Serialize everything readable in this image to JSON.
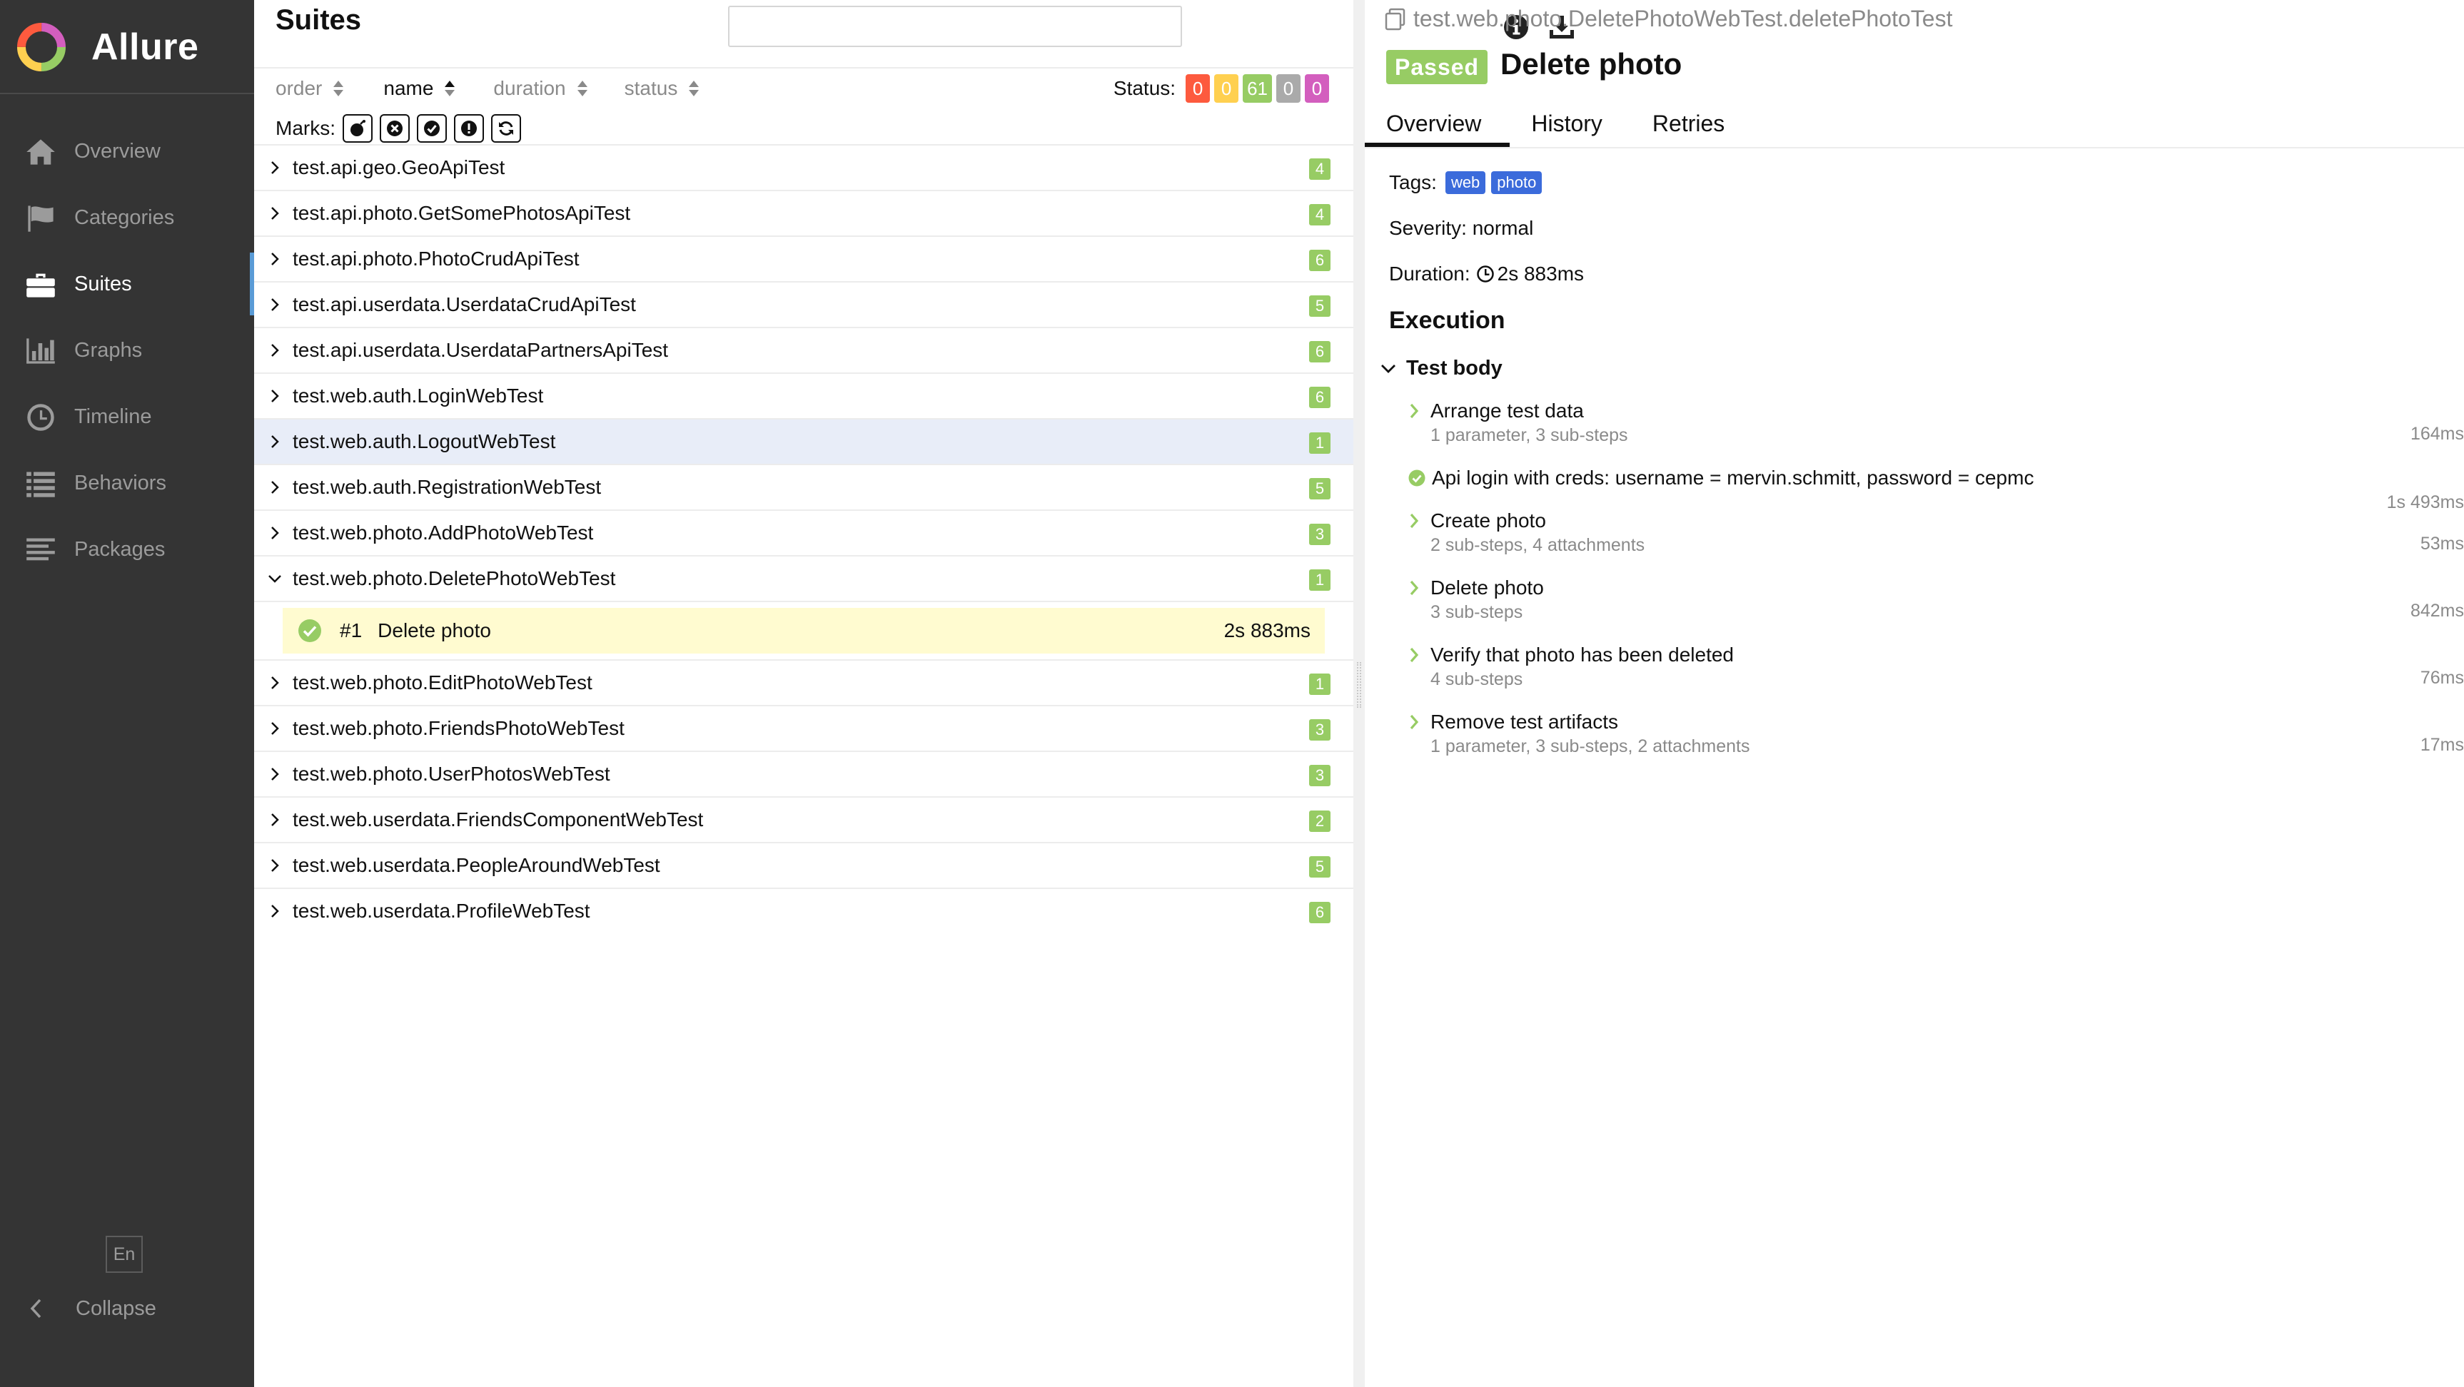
{
  "brand": {
    "name": "Allure"
  },
  "sidebar": {
    "items": [
      {
        "label": "Overview",
        "icon": "home-icon"
      },
      {
        "label": "Categories",
        "icon": "flag-icon"
      },
      {
        "label": "Suites",
        "icon": "briefcase-icon",
        "active": true
      },
      {
        "label": "Graphs",
        "icon": "bar-chart-icon"
      },
      {
        "label": "Timeline",
        "icon": "clock-icon"
      },
      {
        "label": "Behaviors",
        "icon": "list-icon"
      },
      {
        "label": "Packages",
        "icon": "align-left-icon"
      }
    ],
    "lang": "En",
    "collapse": "Collapse"
  },
  "suites": {
    "title": "Suites",
    "search": {
      "value": "",
      "placeholder": ""
    },
    "sorters": [
      "order",
      "name",
      "duration",
      "status"
    ],
    "active_sorter": "name",
    "status_label": "Status:",
    "status_counts": [
      {
        "value": "0",
        "color": "#fd5a3e"
      },
      {
        "value": "0",
        "color": "#ffd050"
      },
      {
        "value": "61",
        "color": "#97cc64"
      },
      {
        "value": "0",
        "color": "#aaaaaa"
      },
      {
        "value": "0",
        "color": "#d35ebe"
      }
    ],
    "marks_label": "Marks:",
    "marks": [
      "flaky-icon",
      "new-failed-icon",
      "new-passed-icon",
      "new-broken-icon",
      "retries-icon"
    ],
    "rows_before": [
      {
        "name": "test.api.geo.GeoApiTest",
        "count": "4"
      },
      {
        "name": "test.api.photo.GetSomePhotosApiTest",
        "count": "4"
      },
      {
        "name": "test.api.photo.PhotoCrudApiTest",
        "count": "6"
      },
      {
        "name": "test.api.userdata.UserdataCrudApiTest",
        "count": "5"
      },
      {
        "name": "test.api.userdata.UserdataPartnersApiTest",
        "count": "6"
      },
      {
        "name": "test.web.auth.LoginWebTest",
        "count": "6"
      },
      {
        "name": "test.web.auth.LogoutWebTest",
        "count": "1"
      },
      {
        "name": "test.web.auth.RegistrationWebTest",
        "count": "5"
      },
      {
        "name": "test.web.photo.AddPhotoWebTest",
        "count": "3"
      },
      {
        "name": "test.web.photo.DeletePhotoWebTest",
        "count": "1"
      }
    ],
    "expanded_case": {
      "num": "#1",
      "name": "Delete photo",
      "duration": "2s 883ms"
    },
    "rows_after": [
      {
        "name": "test.web.photo.EditPhotoWebTest",
        "count": "1"
      },
      {
        "name": "test.web.photo.FriendsPhotoWebTest",
        "count": "3"
      },
      {
        "name": "test.web.photo.UserPhotosWebTest",
        "count": "3"
      },
      {
        "name": "test.web.userdata.FriendsComponentWebTest",
        "count": "2"
      },
      {
        "name": "test.web.userdata.PeopleAroundWebTest",
        "count": "5"
      },
      {
        "name": "test.web.userdata.ProfileWebTest",
        "count": "6"
      }
    ]
  },
  "detail": {
    "full_name": "test.web.photo.DeletePhotoWebTest.deletePhotoTest",
    "status": "Passed",
    "title": "Delete photo",
    "tabs": [
      "Overview",
      "History",
      "Retries"
    ],
    "tags_label": "Tags:",
    "tags": [
      "web",
      "photo"
    ],
    "severity": "Severity: normal",
    "duration_label": "Duration:",
    "duration": "2s 883ms",
    "execution": "Execution",
    "test_body": "Test body",
    "steps": [
      {
        "name": "Arrange test data",
        "sub": "1 parameter, 3 sub-steps",
        "duration": "164ms",
        "kind": "expandable"
      },
      {
        "name": "Api login with creds: username = mervin.schmitt, password = cepmc",
        "sub": "",
        "duration": "1s 493ms",
        "kind": "passed"
      },
      {
        "name": "Create photo",
        "sub": "2 sub-steps, 4 attachments",
        "duration": "53ms",
        "kind": "expandable"
      },
      {
        "name": "Delete photo",
        "sub": "3 sub-steps",
        "duration": "842ms",
        "kind": "expandable"
      },
      {
        "name": "Verify that photo has been deleted",
        "sub": "4 sub-steps",
        "duration": "76ms",
        "kind": "expandable"
      },
      {
        "name": "Remove test artifacts",
        "sub": "1 parameter, 3 sub-steps, 2 attachments",
        "duration": "17ms",
        "kind": "expandable"
      }
    ]
  }
}
